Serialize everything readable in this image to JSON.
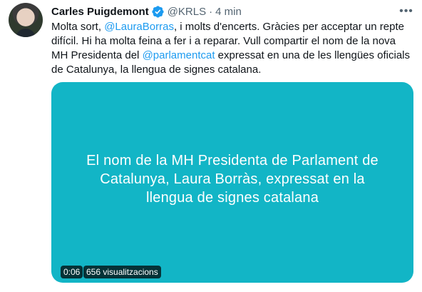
{
  "tweet": {
    "author_name": "Carles Puigdemont",
    "handle": "@KRLS",
    "separator": "·",
    "time": "4 min",
    "text_parts": [
      "Molta sort, ",
      "@LauraBorras",
      ", i molts d'encerts. Gràcies per acceptar un repte difícil. Hi ha molta feina a fer i a reparar. Vull compartir el nom de la nova MH Presidenta del ",
      "@parlamentcat",
      " expressat en una de les llengües oficials de Catalunya, la llengua de signes catalana."
    ]
  },
  "video": {
    "caption_lines": [
      "El nom de la MH Presidenta de Parlament de",
      "Catalunya, Laura Borràs, expressat en la",
      "llengua de signes catalana"
    ],
    "duration": "0:06",
    "views": "656 visualitzacions",
    "background_color": "#12b5c6"
  },
  "icons": {
    "verified": "verified-badge-icon",
    "more": "more-options-icon"
  },
  "colors": {
    "link": "#1d9bf0",
    "secondary_text": "#536471",
    "verified": "#1d9bf0"
  }
}
